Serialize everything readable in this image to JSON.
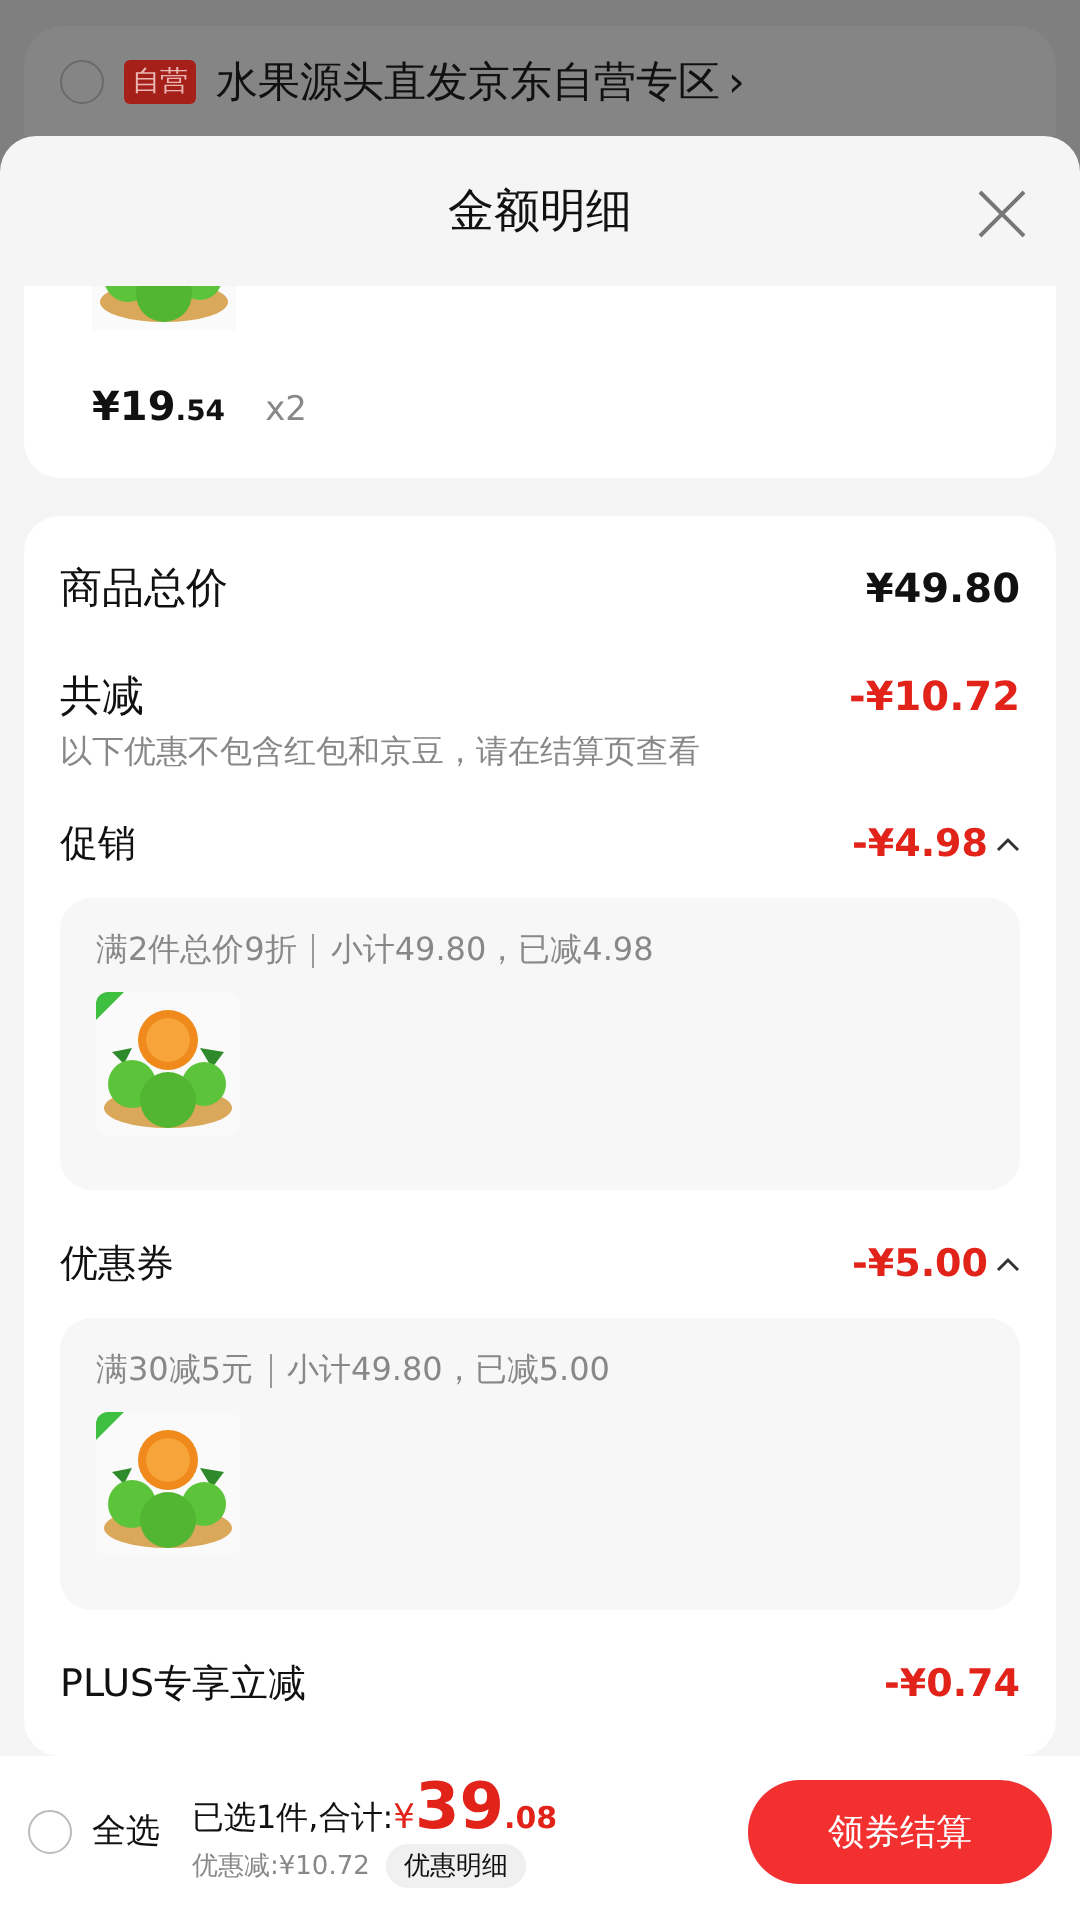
{
  "background_store": {
    "selected": false,
    "badge": "自营",
    "name": "水果源头直发京东自营专区",
    "chevron": "›"
  },
  "sheet": {
    "title": "金额明细"
  },
  "product": {
    "price_main": "¥19",
    "price_decimal": ".54",
    "quantity": "x2"
  },
  "summary": {
    "total_label": "商品总价",
    "total_value": "¥49.80",
    "discount_label": "共减",
    "discount_value": "-¥10.72",
    "note": "以下优惠不包含红包和京豆，请在结算页查看"
  },
  "sections": [
    {
      "kind": "expandable",
      "label": "促销",
      "value": "-¥4.98",
      "expanded": true,
      "rule": "满2件总价9折",
      "subtotal": "小计49.80，已减4.98"
    },
    {
      "kind": "expandable",
      "label": "优惠券",
      "value": "-¥5.00",
      "expanded": true,
      "rule": "满30减5元",
      "subtotal": "小计49.80，已减5.00"
    },
    {
      "kind": "plain",
      "label": "PLUS专享立减",
      "value": "-¥0.74"
    }
  ],
  "bottom_bar": {
    "select_all": {
      "label": "全选",
      "checked": false
    },
    "selected_count": "已选1件,合计:",
    "currency": "¥",
    "total_main": "39",
    "total_decimal": ".08",
    "savings": "优惠减:¥10.72",
    "details_button": "优惠明细",
    "checkout_button": "领券结算"
  }
}
